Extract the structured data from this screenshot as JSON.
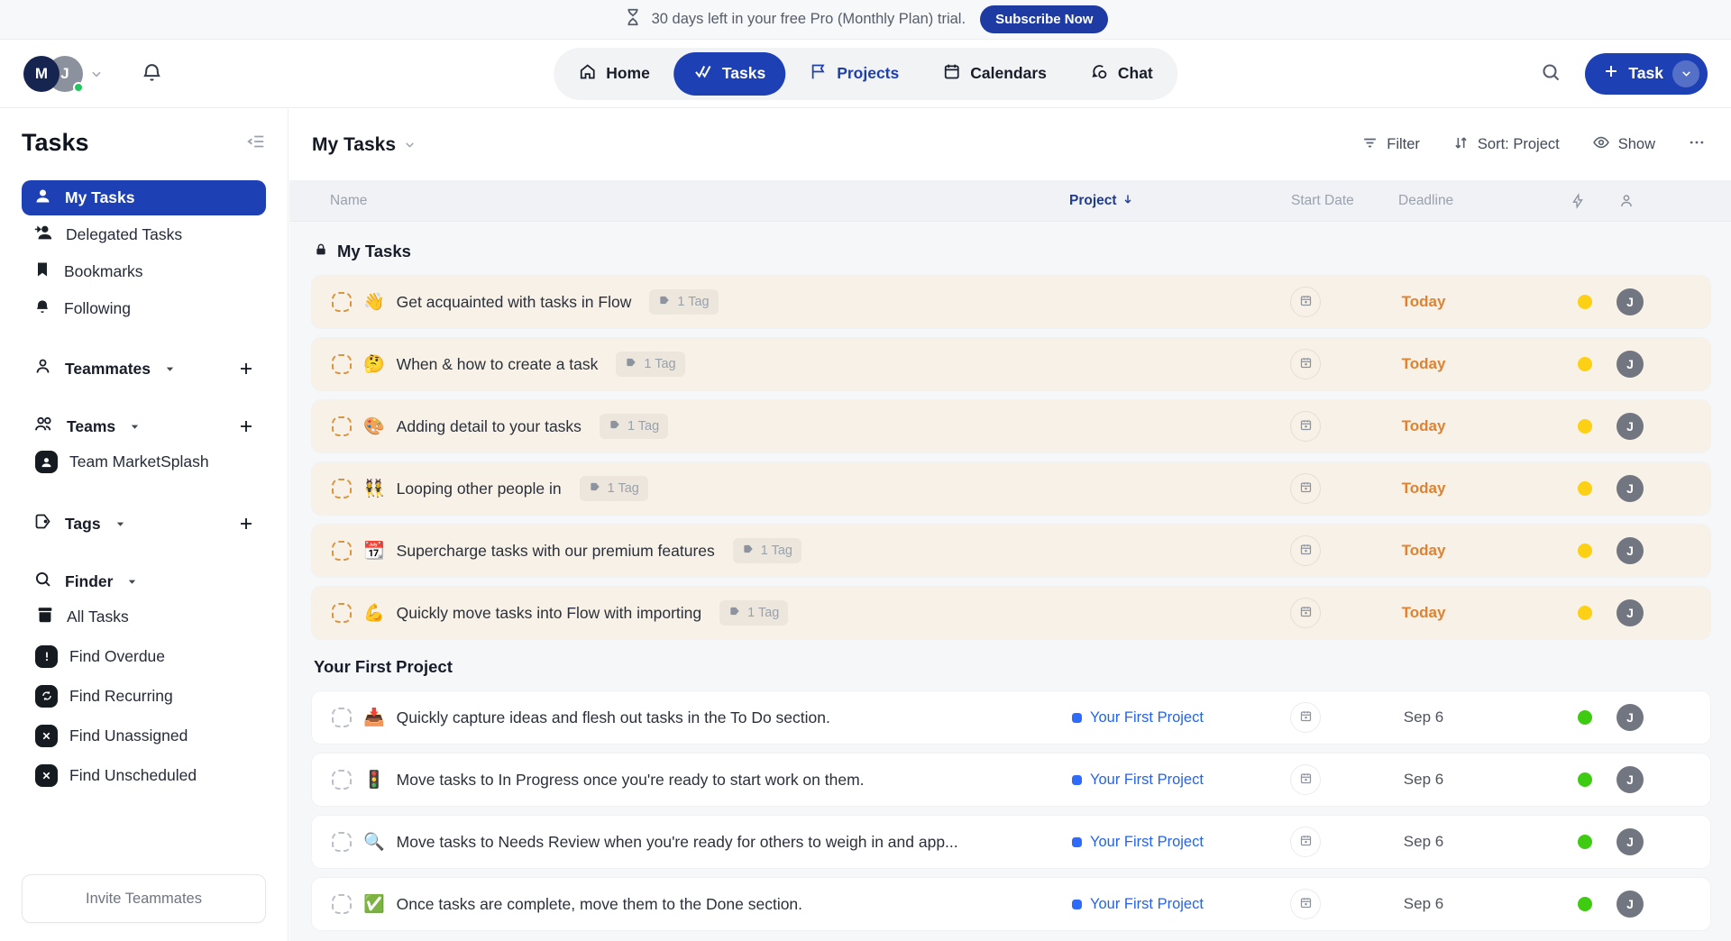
{
  "banner": {
    "message": "30 days left in your free Pro (Monthly Plan) trial.",
    "cta_label": "Subscribe Now"
  },
  "header": {
    "avatar_m": "M",
    "avatar_j": "J",
    "nav": {
      "home": "Home",
      "tasks": "Tasks",
      "projects": "Projects",
      "calendars": "Calendars",
      "chat": "Chat"
    },
    "task_button_label": "Task"
  },
  "sidebar": {
    "title": "Tasks",
    "items": [
      {
        "label": "My Tasks"
      },
      {
        "label": "Delegated Tasks"
      },
      {
        "label": "Bookmarks"
      },
      {
        "label": "Following"
      }
    ],
    "teammates_label": "Teammates",
    "teams_label": "Teams",
    "team_item_label": "Team MarketSplash",
    "tags_label": "Tags",
    "finder_label": "Finder",
    "finder_items": [
      {
        "label": "All Tasks"
      },
      {
        "label": "Find Overdue"
      },
      {
        "label": "Find Recurring"
      },
      {
        "label": "Find Unassigned"
      },
      {
        "label": "Find Unscheduled"
      }
    ],
    "invite_label": "Invite Teammates"
  },
  "toolbar": {
    "view_title": "My Tasks",
    "filter_label": "Filter",
    "sort_label": "Sort: Project",
    "show_label": "Show"
  },
  "table": {
    "col_name": "Name",
    "col_project": "Project",
    "col_start": "Start Date",
    "col_deadline": "Deadline"
  },
  "groups": [
    {
      "title": "My Tasks",
      "locked": true,
      "row_style": "cream",
      "rows": [
        {
          "emoji": "👋",
          "title": "Get acquainted with tasks in Flow",
          "tag": "1 Tag",
          "deadline": "Today",
          "deadline_urgent": true,
          "dot": "yellow",
          "assignee": "J"
        },
        {
          "emoji": "🤔",
          "title": "When & how to create a task",
          "tag": "1 Tag",
          "deadline": "Today",
          "deadline_urgent": true,
          "dot": "yellow",
          "assignee": "J"
        },
        {
          "emoji": "🎨",
          "title": "Adding detail to your tasks",
          "tag": "1 Tag",
          "deadline": "Today",
          "deadline_urgent": true,
          "dot": "yellow",
          "assignee": "J"
        },
        {
          "emoji": "👯",
          "title": "Looping other people in",
          "tag": "1 Tag",
          "deadline": "Today",
          "deadline_urgent": true,
          "dot": "yellow",
          "assignee": "J"
        },
        {
          "emoji": "📆",
          "title": "Supercharge tasks with our premium features",
          "tag": "1 Tag",
          "deadline": "Today",
          "deadline_urgent": true,
          "dot": "yellow",
          "assignee": "J"
        },
        {
          "emoji": "💪",
          "title": "Quickly move tasks into Flow with importing",
          "tag": "1 Tag",
          "deadline": "Today",
          "deadline_urgent": true,
          "dot": "yellow",
          "assignee": "J"
        }
      ]
    },
    {
      "title": "Your First Project",
      "locked": false,
      "row_style": "white",
      "rows": [
        {
          "emoji": "📥",
          "title": "Quickly capture ideas and flesh out tasks in the To Do section.",
          "project": "Your First Project",
          "deadline": "Sep 6",
          "dot": "green",
          "assignee": "J"
        },
        {
          "emoji": "🚦",
          "title": "Move tasks to In Progress once you're ready to start work on them.",
          "project": "Your First Project",
          "deadline": "Sep 6",
          "dot": "green",
          "assignee": "J"
        },
        {
          "emoji": "🔍",
          "title": "Move tasks to Needs Review when you're ready for others to weigh in and app...",
          "project": "Your First Project",
          "deadline": "Sep 6",
          "dot": "green",
          "assignee": "J"
        },
        {
          "emoji": "✅",
          "title": "Once tasks are complete, move them to the Done section.",
          "project": "Your First Project",
          "deadline": "Sep 6",
          "dot": "green",
          "assignee": "J"
        }
      ]
    }
  ],
  "colors": {
    "accent_blue": "#1d40b5",
    "link_blue": "#2563eb",
    "today_orange": "#e0822f",
    "dot_yellow": "#fcd015",
    "dot_green": "#3ecb12",
    "cream_row": "#f8f1e7"
  }
}
